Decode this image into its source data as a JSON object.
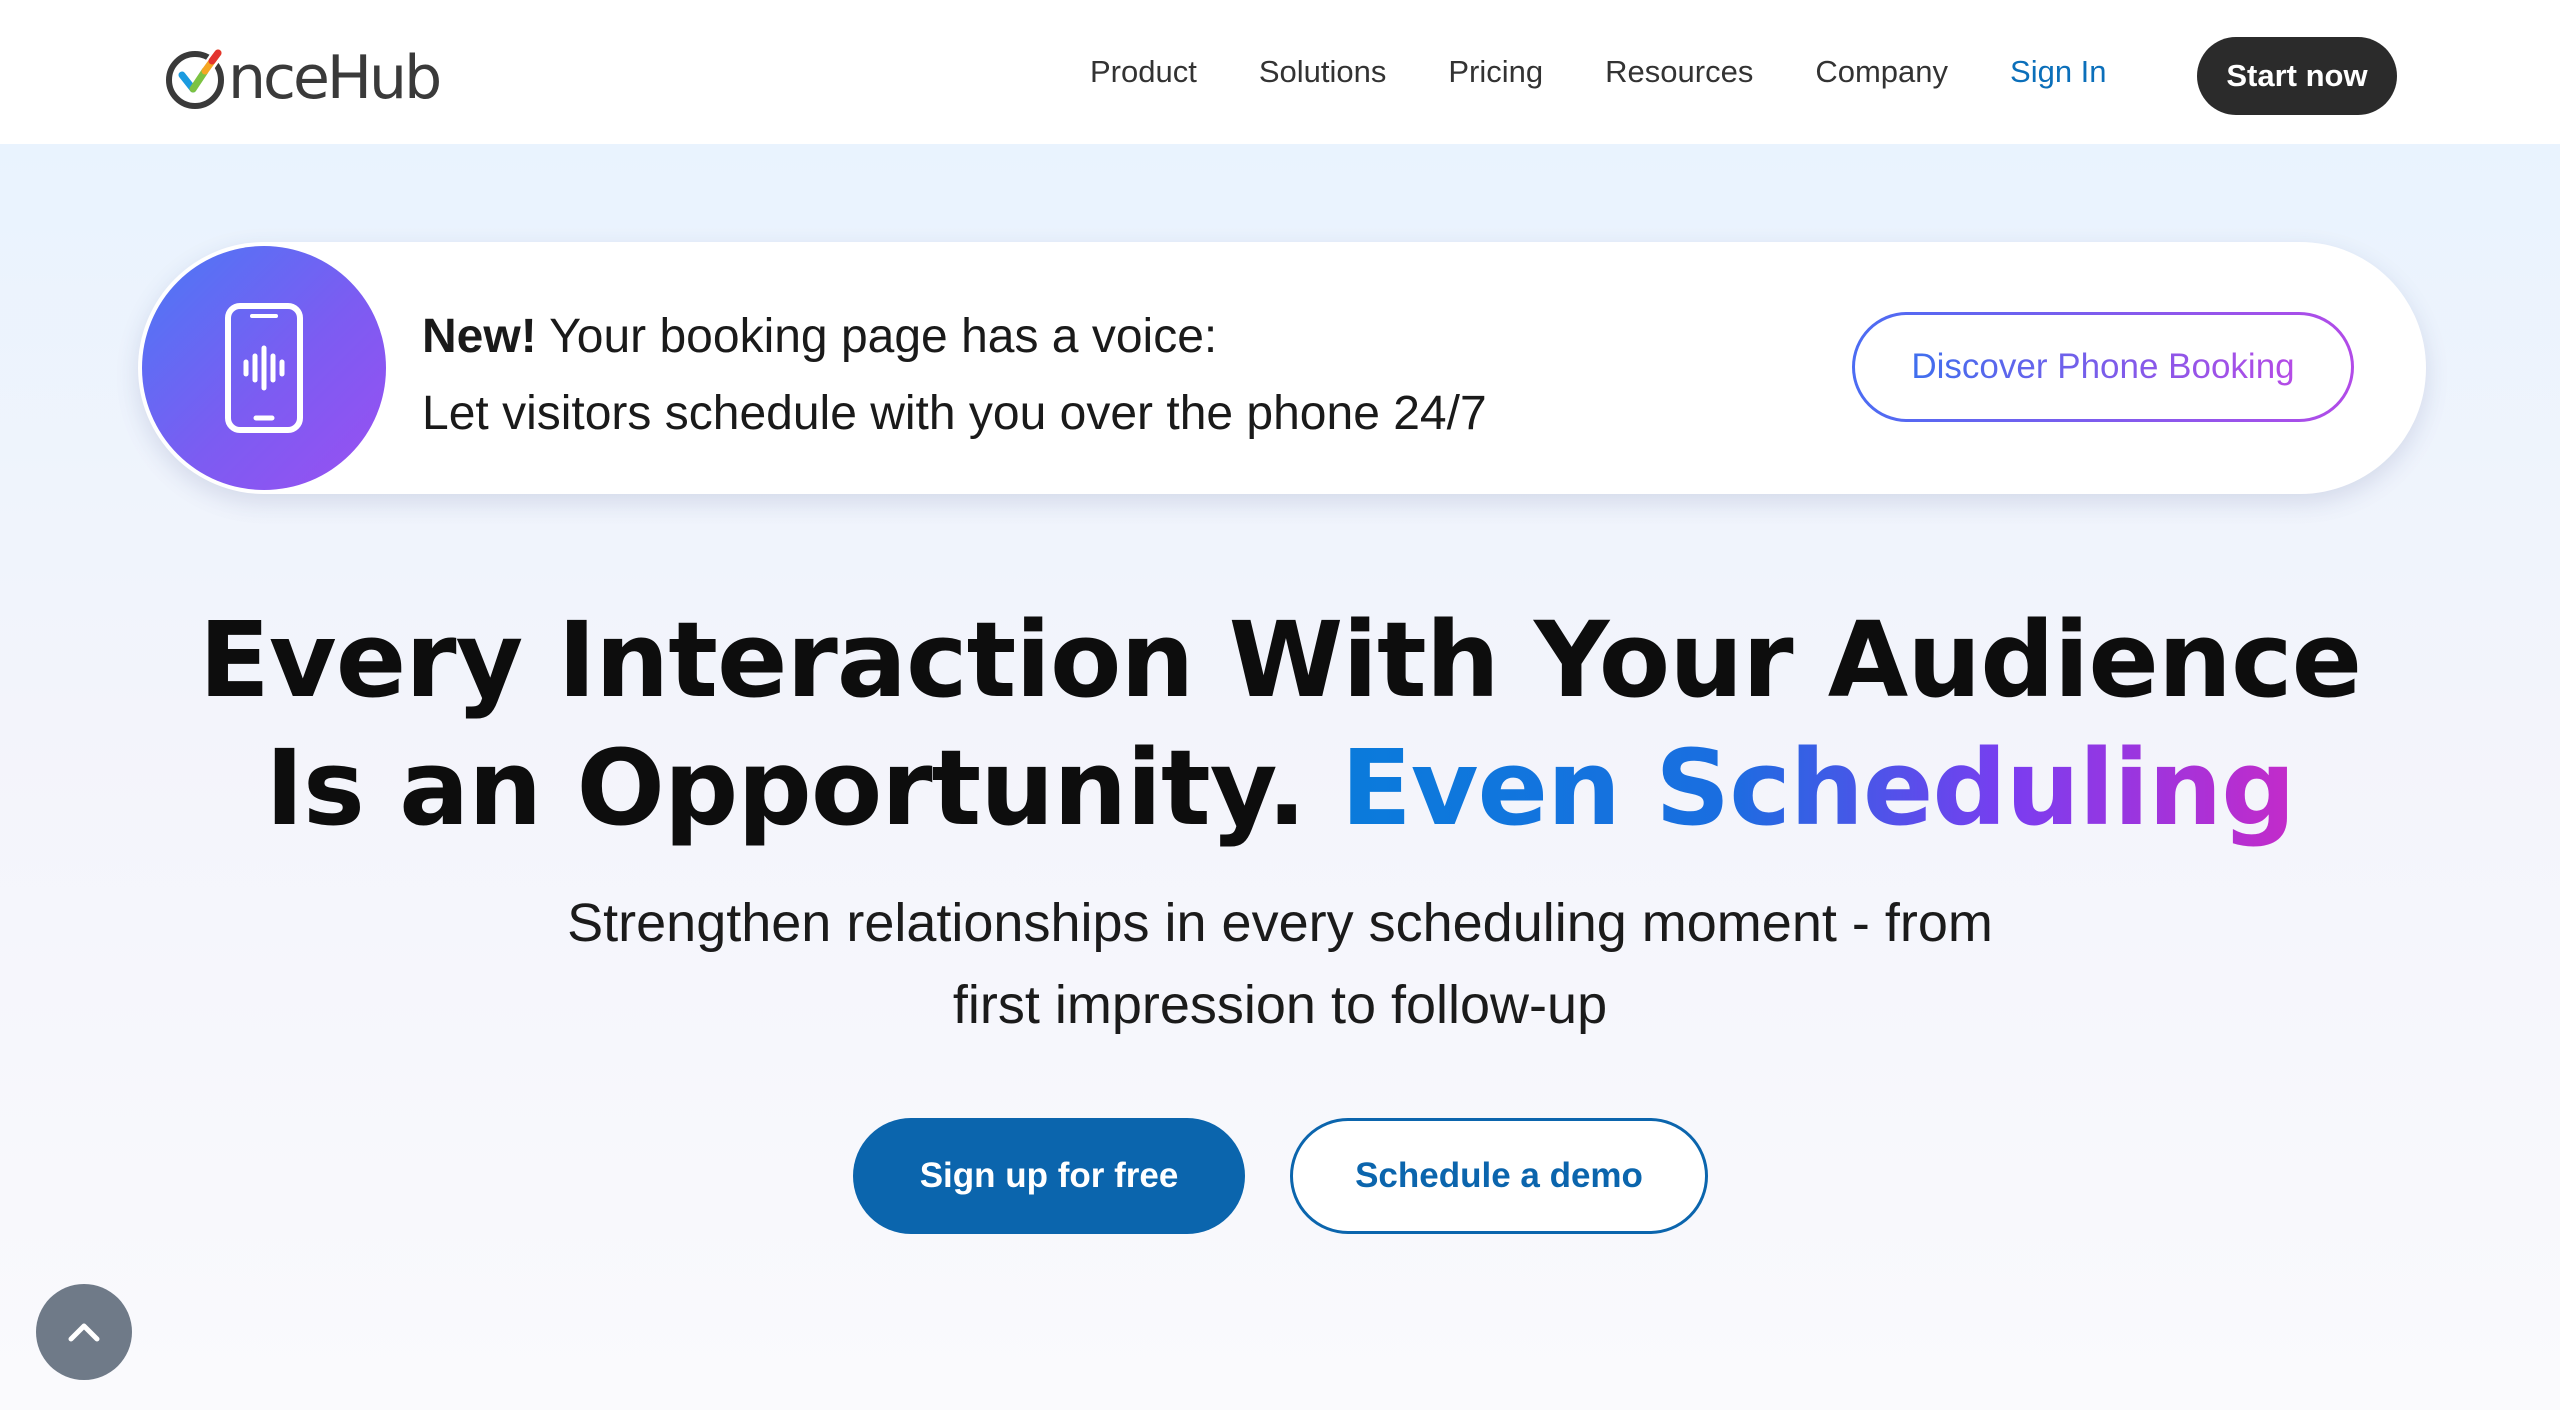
{
  "header": {
    "logo_text": "nceHub",
    "nav": [
      "Product",
      "Solutions",
      "Pricing",
      "Resources",
      "Company"
    ],
    "sign_in": "Sign In",
    "start_now": "Start now"
  },
  "banner": {
    "new_label": "New!",
    "line1": "Your booking page has a voice:",
    "line2": "Let visitors schedule with you over the phone 24/7",
    "button": "Discover Phone Booking"
  },
  "hero": {
    "headline_line1": "Every Interaction With Your Audience",
    "headline_line2_plain": "Is an Opportunity.",
    "headline_line2_highlight": "Even Scheduling",
    "subhead_line1": "Strengthen relationships in every scheduling moment - from",
    "subhead_line2": "first impression to follow-up",
    "cta_primary": "Sign up for free",
    "cta_secondary": "Schedule a demo"
  },
  "colors": {
    "brand_blue": "#0b65ad",
    "dark_button": "#2b2b2b",
    "sign_in": "#0b6fba"
  },
  "icons": [
    "oncehub-logo-icon",
    "phone-voice-icon",
    "chevron-up-icon"
  ]
}
